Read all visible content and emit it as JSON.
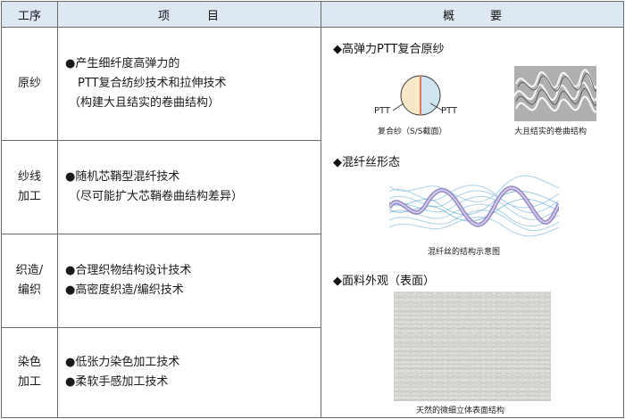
{
  "header": {
    "process": "工序",
    "item_left": "项",
    "item_right": "目",
    "overview_left": "概",
    "overview_right": "要"
  },
  "rows": [
    {
      "process_lines": [
        "原纱"
      ],
      "item_lines": [
        "●产生细纤度高弹力的",
        "PTT复合纺纱技术和拉伸技术",
        "（构建大且结实的卷曲结构）"
      ]
    },
    {
      "process_lines": [
        "纱线",
        "加工"
      ],
      "item_lines": [
        "●随机芯鞘型混纤技术",
        "（尽可能扩大芯鞘卷曲结构差异）"
      ]
    },
    {
      "process_lines": [
        "织造/",
        "编织"
      ],
      "item_lines": [
        "●合理织物结构设计技术",
        "●高密度织造/编织技术"
      ]
    },
    {
      "process_lines": [
        "染色",
        "加工"
      ],
      "item_lines": [
        "●低张力染色加工技术",
        "●柔软手感加工技术"
      ]
    }
  ],
  "overview": {
    "section1_title": "◆高弹力PTT复合原纱",
    "pie_label_left": "PTT",
    "pie_label_right": "PTT",
    "caption_pie": "复合纱（S/S截面）",
    "caption_crimp": "大且结实的卷曲结构",
    "section2_title": "◆混纤丝形态",
    "caption_blend": "混纤丝的结构示意图",
    "section3_title": "◆面料外观（表面）",
    "caption_fabric": "天然的微细立体表面结构"
  },
  "colors": {
    "header_bg": "#dde8f3",
    "border": "#6a6a6a",
    "pie_left": "#f9e8c8",
    "pie_right": "#cfe6f1",
    "pie_divider": "#e07a5f"
  }
}
